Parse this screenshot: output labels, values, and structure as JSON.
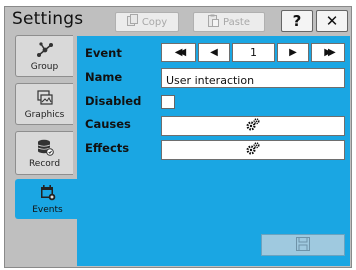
{
  "window": {
    "title": "Settings"
  },
  "toolbar": {
    "copy_label": "Copy",
    "paste_label": "Paste",
    "help_label": "?",
    "close_label": "✕"
  },
  "tabs": [
    {
      "label": "Group",
      "icon": "group-icon"
    },
    {
      "label": "Graphics",
      "icon": "graphics-icon"
    },
    {
      "label": "Record",
      "icon": "record-icon"
    },
    {
      "label": "Events",
      "icon": "events-icon",
      "active": true
    }
  ],
  "form": {
    "event_label": "Event",
    "event_value": "1",
    "nav": {
      "first": "◀◀",
      "prev": "◀",
      "next": "▶",
      "last": "▶▶"
    },
    "name_label": "Name",
    "name_value": "User interaction",
    "disabled_label": "Disabled",
    "disabled_checked": false,
    "causes_label": "Causes",
    "causes_icon": "gears-icon",
    "effects_label": "Effects",
    "effects_icon": "gears-icon"
  },
  "colors": {
    "accent": "#1aa6e3",
    "window_bg": "#bfbfbf"
  }
}
